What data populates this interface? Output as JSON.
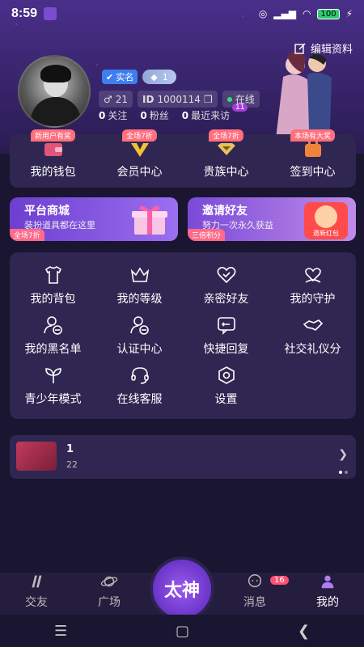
{
  "statusbar": {
    "time": "8:59",
    "battery": "100"
  },
  "profile": {
    "edit_label": "编辑资料",
    "badge_real": "实名",
    "badge_gem_level": "1",
    "level_num": "21",
    "id_label": "ID",
    "id_value": "1000114",
    "online_label": "在线",
    "mini_badge": "11",
    "stats": [
      {
        "value": "0",
        "label": "关注"
      },
      {
        "value": "0",
        "label": "粉丝"
      },
      {
        "value": "0",
        "label": "最近来访"
      }
    ]
  },
  "quick": [
    {
      "label": "我的钱包",
      "tag": "新用户有奖",
      "icon": "wallet-icon"
    },
    {
      "label": "会员中心",
      "tag": "全场7折",
      "icon": "vip-icon"
    },
    {
      "label": "贵族中心",
      "tag": "全场7折",
      "icon": "noble-icon"
    },
    {
      "label": "签到中心",
      "tag": "本场有大奖",
      "icon": "checkin-icon"
    }
  ],
  "promo": {
    "mall": {
      "title": "平台商城",
      "subtitle": "装扮道具都在这里",
      "tag": "全场7折"
    },
    "invite": {
      "title": "邀请好友",
      "subtitle": "努力一次永久获益",
      "tag": "三倍积分",
      "redpack_label": "邀新红包"
    }
  },
  "grid": [
    {
      "label": "我的背包",
      "icon": "backpack-icon"
    },
    {
      "label": "我的等级",
      "icon": "level-icon"
    },
    {
      "label": "亲密好友",
      "icon": "heart-friend-icon"
    },
    {
      "label": "我的守护",
      "icon": "guard-icon"
    },
    {
      "label": "我的黑名单",
      "icon": "blacklist-icon"
    },
    {
      "label": "认证中心",
      "icon": "certify-icon"
    },
    {
      "label": "快捷回复",
      "icon": "quick-reply-icon"
    },
    {
      "label": "社交礼仪分",
      "icon": "handshake-icon"
    },
    {
      "label": "青少年模式",
      "icon": "sprout-icon"
    },
    {
      "label": "在线客服",
      "icon": "headset-icon"
    },
    {
      "label": "设置",
      "icon": "settings-icon"
    }
  ],
  "feed": {
    "title": "1",
    "subtitle": "22"
  },
  "tabs": [
    {
      "label": "交友",
      "icon": "dating-icon"
    },
    {
      "label": "广场",
      "icon": "planet-icon"
    },
    {
      "label": "太神",
      "icon": "center-icon"
    },
    {
      "label": "消息",
      "icon": "message-icon",
      "badge": "16"
    },
    {
      "label": "我的",
      "icon": "me-icon"
    }
  ],
  "colors": {
    "panel": "#2f2652",
    "accent": "#9a5af0",
    "tag": "#ff6f7d"
  }
}
